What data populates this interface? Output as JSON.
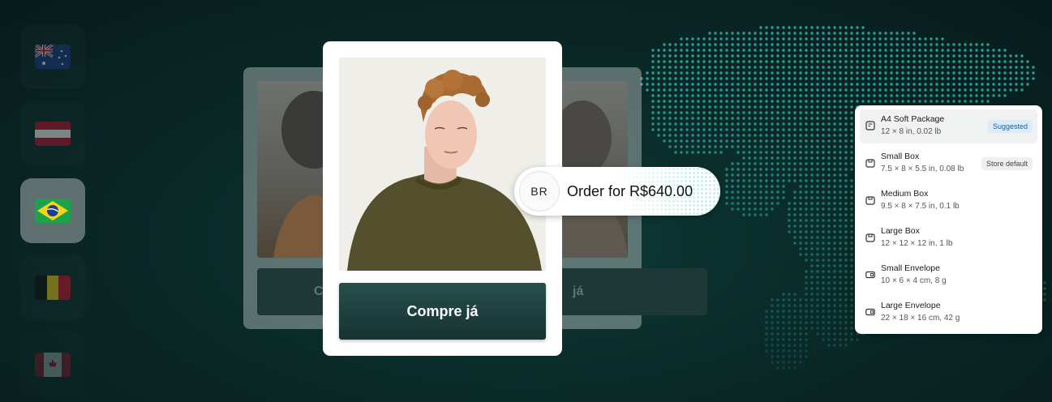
{
  "flags": [
    {
      "country": "Australia",
      "icon": "australia-flag-icon",
      "state": "dim"
    },
    {
      "country": "Austria",
      "icon": "austria-flag-icon",
      "state": "dim"
    },
    {
      "country": "Brazil",
      "icon": "brazil-flag-icon",
      "state": "active"
    },
    {
      "country": "Belgium",
      "icon": "belgium-flag-icon",
      "state": "dim"
    },
    {
      "country": "Canada",
      "icon": "canada-flag-icon",
      "state": "faded"
    }
  ],
  "product": {
    "buy_label": "Compre já",
    "bg_left_fragment": "C",
    "bg_right_fragment": "já"
  },
  "order": {
    "country_code": "BR",
    "text": "Order for R$640.00"
  },
  "packages": [
    {
      "name": "A4 Soft Package",
      "dims": "12 × 8 in, 0.02 lb",
      "badge": "Suggested",
      "icon": "package-icon"
    },
    {
      "name": "Small Box",
      "dims": "7.5 × 8 × 5.5 in, 0.08 lb",
      "badge": "Store default",
      "icon": "box-icon"
    },
    {
      "name": "Medium Box",
      "dims": "9.5 × 8 × 7.5 in, 0.1 lb",
      "badge": "",
      "icon": "box-icon"
    },
    {
      "name": "Large Box",
      "dims": "12 × 12 × 12 in, 1 lb",
      "badge": "",
      "icon": "box-icon"
    },
    {
      "name": "Small Envelope",
      "dims": "10 × 6 × 4 cm, 8 g",
      "badge": "",
      "icon": "envelope-icon"
    },
    {
      "name": "Large Envelope",
      "dims": "22 × 18 × 16 cm, 42 g",
      "badge": "",
      "icon": "envelope-icon"
    }
  ],
  "colors": {
    "background": "#0a2a28",
    "accent": "#1d5f8e",
    "button": "#1f423f",
    "map_dots": "#2fb5aa"
  }
}
